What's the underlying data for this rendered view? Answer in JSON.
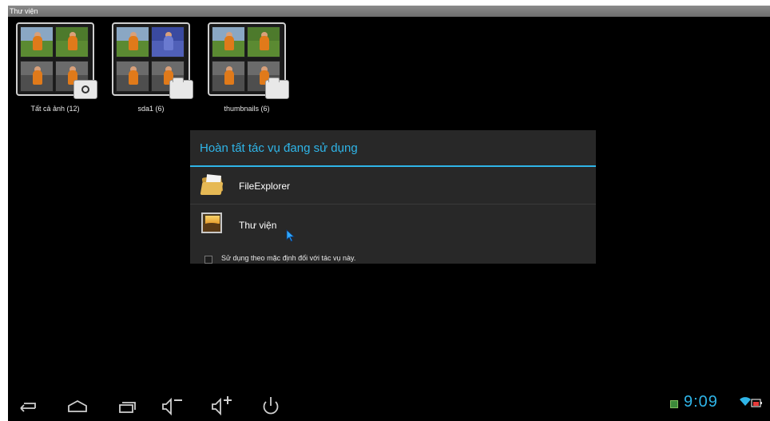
{
  "window": {
    "title": "Thư viện"
  },
  "albums": [
    {
      "label": "Tất cả ảnh (12)",
      "badge": "camera-icon"
    },
    {
      "label": "sda1 (6)",
      "badge": "folder-icon"
    },
    {
      "label": "thumbnails (6)",
      "badge": "folder-icon"
    }
  ],
  "dialog": {
    "title": "Hoàn tất tác vụ đang sử dụng",
    "items": [
      {
        "label": "FileExplorer",
        "icon": "file-explorer-icon"
      },
      {
        "label": "Thư viện",
        "icon": "gallery-icon"
      }
    ],
    "checkbox_label": "Sử dụng theo mặc định đối với tác vụ này.",
    "checkbox_checked": false
  },
  "statusbar": {
    "time": "9:09"
  },
  "colors": {
    "accent": "#2fb5e8",
    "dialog_bg": "#282828",
    "screen_bg": "#000000"
  },
  "navbar": {
    "buttons": [
      "back-icon",
      "home-icon",
      "recent-apps-icon",
      "volume-down-icon",
      "volume-up-icon",
      "power-icon"
    ]
  }
}
